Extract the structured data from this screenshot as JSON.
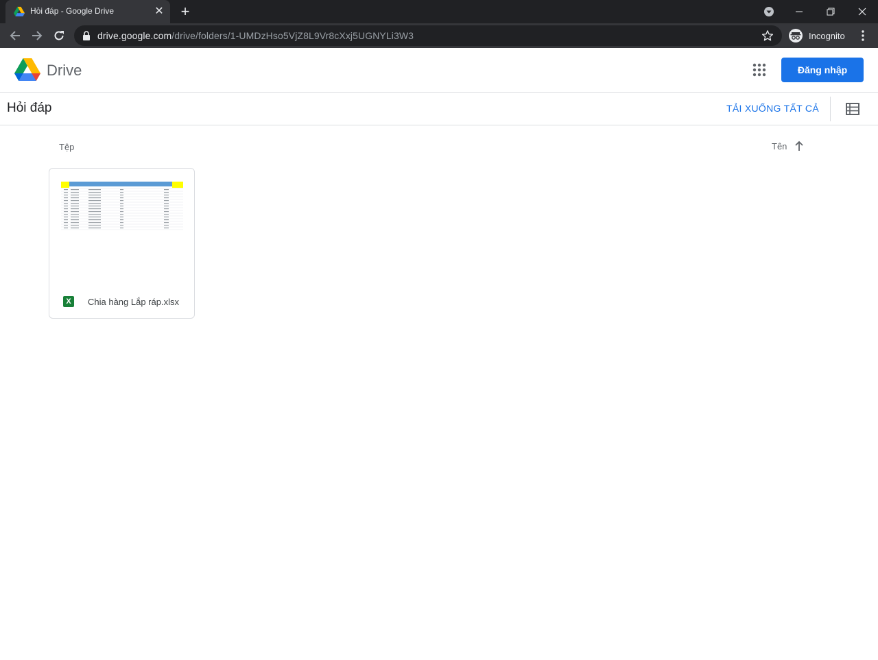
{
  "browser": {
    "tab_title": "Hỏi đáp - Google Drive",
    "url_host": "drive.google.com",
    "url_path": "/drive/folders/1-UMDzHso5VjZ8L9Vr8cXxj5UGNYLi3W3",
    "incognito_label": "Incognito",
    "new_tab_glyph": "+",
    "close_tab_glyph": "✕"
  },
  "header": {
    "app_name": "Drive",
    "signin_label": "Đăng nhập"
  },
  "folder": {
    "title": "Hỏi đáp",
    "download_all_label": "TẢI XUỐNG TẤT CẢ"
  },
  "content": {
    "section_label": "Tệp",
    "sort_label": "Tên",
    "files": [
      {
        "name": "Chia hàng Lắp ráp.xlsx",
        "type_icon": "X"
      }
    ]
  },
  "colors": {
    "accent": "#1a73e8",
    "sheet_icon": "#188038",
    "chrome_dark": "#202124",
    "chrome_toolbar": "#35363a"
  }
}
